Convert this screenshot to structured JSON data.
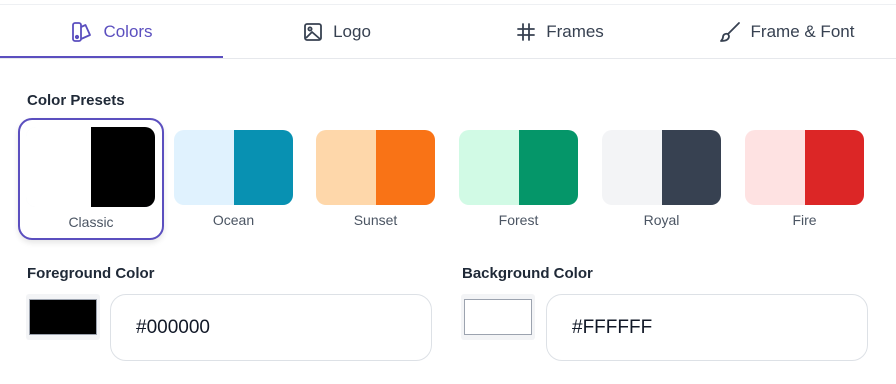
{
  "tabs": [
    {
      "label": "Colors",
      "icon": "palette-icon",
      "active": true
    },
    {
      "label": "Logo",
      "icon": "image-icon",
      "active": false
    },
    {
      "label": "Frames",
      "icon": "grid-icon",
      "active": false
    },
    {
      "label": "Frame & Font",
      "icon": "brush-icon",
      "active": false
    }
  ],
  "presets_title": "Color Presets",
  "presets": [
    {
      "name": "Classic",
      "colors": [
        "#ffffff",
        "#000000"
      ],
      "selected": true
    },
    {
      "name": "Ocean",
      "colors": [
        "#e0f2fe",
        "#0891b2"
      ],
      "selected": false
    },
    {
      "name": "Sunset",
      "colors": [
        "#fed7aa",
        "#f97316"
      ],
      "selected": false
    },
    {
      "name": "Forest",
      "colors": [
        "#d1fae5",
        "#059669"
      ],
      "selected": false
    },
    {
      "name": "Royal",
      "colors": [
        "#f3f4f6",
        "#374151"
      ],
      "selected": false
    },
    {
      "name": "Fire",
      "colors": [
        "#fee2e2",
        "#dc2626"
      ],
      "selected": false
    }
  ],
  "foreground": {
    "label": "Foreground Color",
    "value": "#000000"
  },
  "background": {
    "label": "Background Color",
    "value": "#FFFFFF"
  },
  "colors": {
    "accent": "#5b4fbf"
  }
}
